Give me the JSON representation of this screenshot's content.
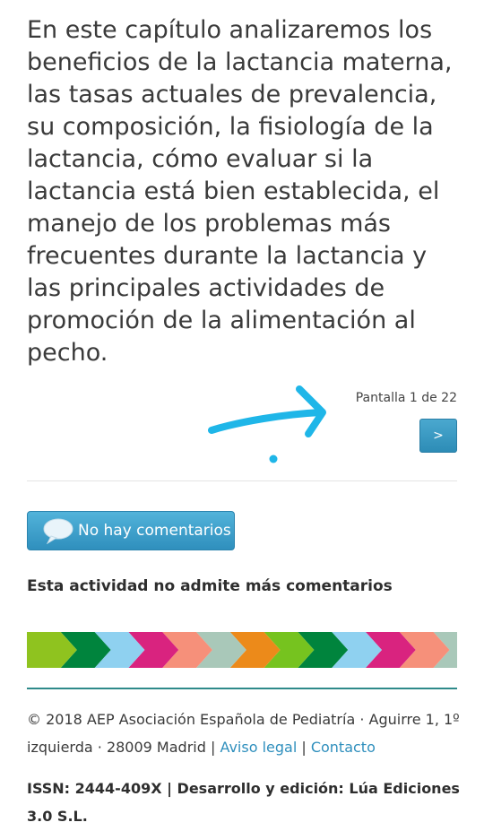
{
  "content": {
    "paragraph": "En este capítulo analizaremos los beneficios de la lactancia materna, las tasas actuales de prevalencia, su composición, la fisiología de la lactancia, cómo evaluar si la lactancia está bien establecida, el manejo de los problemas más frecuentes durante la lactancia y las principales actividades de promoción de la alimentación al pecho."
  },
  "pagination": {
    "counter": "Pantalla 1 de 22",
    "next_label": ">"
  },
  "comments": {
    "button_label": "No hay comentarios",
    "closed_notice": "Esta actividad no admite más comentarios"
  },
  "banner": {
    "colors": [
      "#8fc31f",
      "#00843d",
      "#8fd1f0",
      "#d9237f",
      "#f6907a",
      "#a9c8b9",
      "#ec8a1a",
      "#76c31f",
      "#00843d",
      "#8fd1f0",
      "#d9237f",
      "#f6907a",
      "#a9c8b9"
    ]
  },
  "footer": {
    "copyright": "© 2018 AEP Asociación Española de Pediatría · Aguirre 1, 1º izquierda · 28009 Madrid | ",
    "legal_link": "Aviso legal",
    "separator": " | ",
    "contact_link": "Contacto",
    "issn": "ISSN: 2444-409X | Desarrollo y edición: Lúa Ediciones 3.0 S.L."
  },
  "colors": {
    "accent": "#2f8fbd",
    "annotation": "#1fb6e8",
    "footer_rule": "#2e8a8a"
  }
}
